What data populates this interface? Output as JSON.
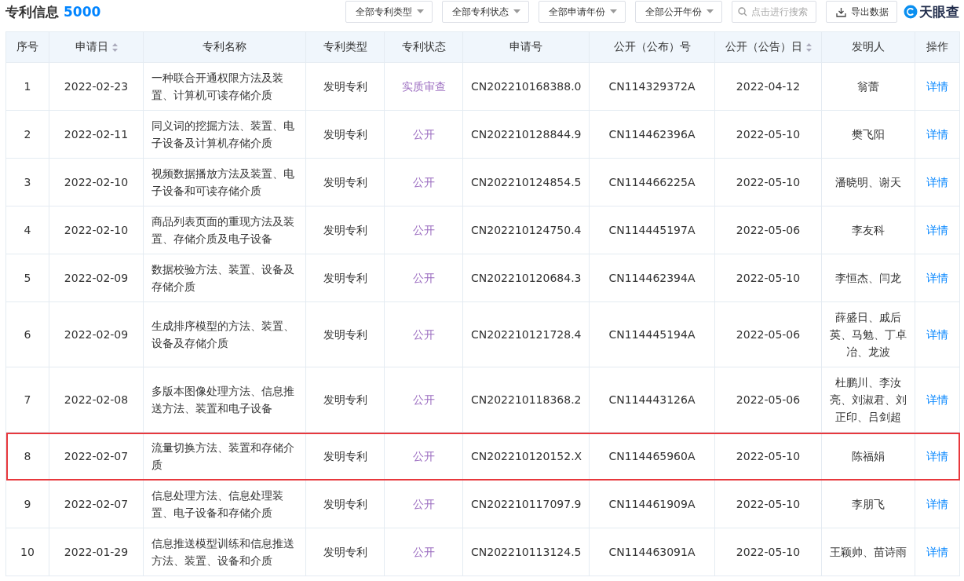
{
  "header": {
    "title": "专利信息",
    "count": "5000"
  },
  "filters": [
    {
      "label": "全部专利类型"
    },
    {
      "label": "全部专利状态"
    },
    {
      "label": "全部申请年份"
    },
    {
      "label": "全部公开年份"
    }
  ],
  "search": {
    "placeholder": "点击进行搜索"
  },
  "export_button": {
    "label": "导出数据"
  },
  "logo": {
    "text": "天眼查"
  },
  "table": {
    "columns": [
      {
        "label": "序号",
        "sortable": false
      },
      {
        "label": "申请日",
        "sortable": true
      },
      {
        "label": "专利名称",
        "sortable": false
      },
      {
        "label": "专利类型",
        "sortable": false
      },
      {
        "label": "专利状态",
        "sortable": false
      },
      {
        "label": "申请号",
        "sortable": false
      },
      {
        "label": "公开（公布）号",
        "sortable": false
      },
      {
        "label": "公开（公告）日",
        "sortable": true
      },
      {
        "label": "发明人",
        "sortable": false
      },
      {
        "label": "操作",
        "sortable": false
      }
    ],
    "rows": [
      {
        "no": "1",
        "date": "2022-02-23",
        "name": "一种联合开通权限方法及装置、计算机可读存储介质",
        "type": "发明专利",
        "status": "实质审查",
        "app_no": "CN202210168388.0",
        "pub_no": "CN114329372A",
        "pub_date": "2022-04-12",
        "inventors": "翁蕾",
        "action": "详情",
        "highlighted": false
      },
      {
        "no": "2",
        "date": "2022-02-11",
        "name": "同义词的挖掘方法、装置、电子设备及计算机存储介质",
        "type": "发明专利",
        "status": "公开",
        "app_no": "CN202210128844.9",
        "pub_no": "CN114462396A",
        "pub_date": "2022-05-10",
        "inventors": "樊飞阳",
        "action": "详情",
        "highlighted": false
      },
      {
        "no": "3",
        "date": "2022-02-10",
        "name": "视频数据播放方法及装置、电子设备和可读存储介质",
        "type": "发明专利",
        "status": "公开",
        "app_no": "CN202210124854.5",
        "pub_no": "CN114466225A",
        "pub_date": "2022-05-10",
        "inventors": "潘晓明、谢天",
        "action": "详情",
        "highlighted": false
      },
      {
        "no": "4",
        "date": "2022-02-10",
        "name": "商品列表页面的重现方法及装置、存储介质及电子设备",
        "type": "发明专利",
        "status": "公开",
        "app_no": "CN202210124750.4",
        "pub_no": "CN114445197A",
        "pub_date": "2022-05-06",
        "inventors": "李友科",
        "action": "详情",
        "highlighted": false
      },
      {
        "no": "5",
        "date": "2022-02-09",
        "name": "数据校验方法、装置、设备及存储介质",
        "type": "发明专利",
        "status": "公开",
        "app_no": "CN202210120684.3",
        "pub_no": "CN114462394A",
        "pub_date": "2022-05-10",
        "inventors": "李恒杰、闫龙",
        "action": "详情",
        "highlighted": false
      },
      {
        "no": "6",
        "date": "2022-02-09",
        "name": "生成排序模型的方法、装置、设备及存储介质",
        "type": "发明专利",
        "status": "公开",
        "app_no": "CN202210121728.4",
        "pub_no": "CN114445194A",
        "pub_date": "2022-05-06",
        "inventors": "薛盛日、戚后英、马勉、丁卓冶、龙波",
        "action": "详情",
        "highlighted": false
      },
      {
        "no": "7",
        "date": "2022-02-08",
        "name": "多版本图像处理方法、信息推送方法、装置和电子设备",
        "type": "发明专利",
        "status": "公开",
        "app_no": "CN202210118368.2",
        "pub_no": "CN114443126A",
        "pub_date": "2022-05-06",
        "inventors": "杜鹏川、李汝亮、刘淑君、刘正印、吕剑超",
        "action": "详情",
        "highlighted": false
      },
      {
        "no": "8",
        "date": "2022-02-07",
        "name": "流量切换方法、装置和存储介质",
        "type": "发明专利",
        "status": "公开",
        "app_no": "CN202210120152.X",
        "pub_no": "CN114465960A",
        "pub_date": "2022-05-10",
        "inventors": "陈福娟",
        "action": "详情",
        "highlighted": true
      },
      {
        "no": "9",
        "date": "2022-02-07",
        "name": "信息处理方法、信息处理装置、电子设备和存储介质",
        "type": "发明专利",
        "status": "公开",
        "app_no": "CN202210117097.9",
        "pub_no": "CN114461909A",
        "pub_date": "2022-05-10",
        "inventors": "李朋飞",
        "action": "详情",
        "highlighted": false
      },
      {
        "no": "10",
        "date": "2022-01-29",
        "name": "信息推送模型训练和信息推送方法、装置、设备和介质",
        "type": "发明专利",
        "status": "公开",
        "app_no": "CN202210113124.5",
        "pub_no": "CN114463091A",
        "pub_date": "2022-05-10",
        "inventors": "王颖帅、苗诗雨",
        "action": "详情",
        "highlighted": false
      }
    ]
  }
}
